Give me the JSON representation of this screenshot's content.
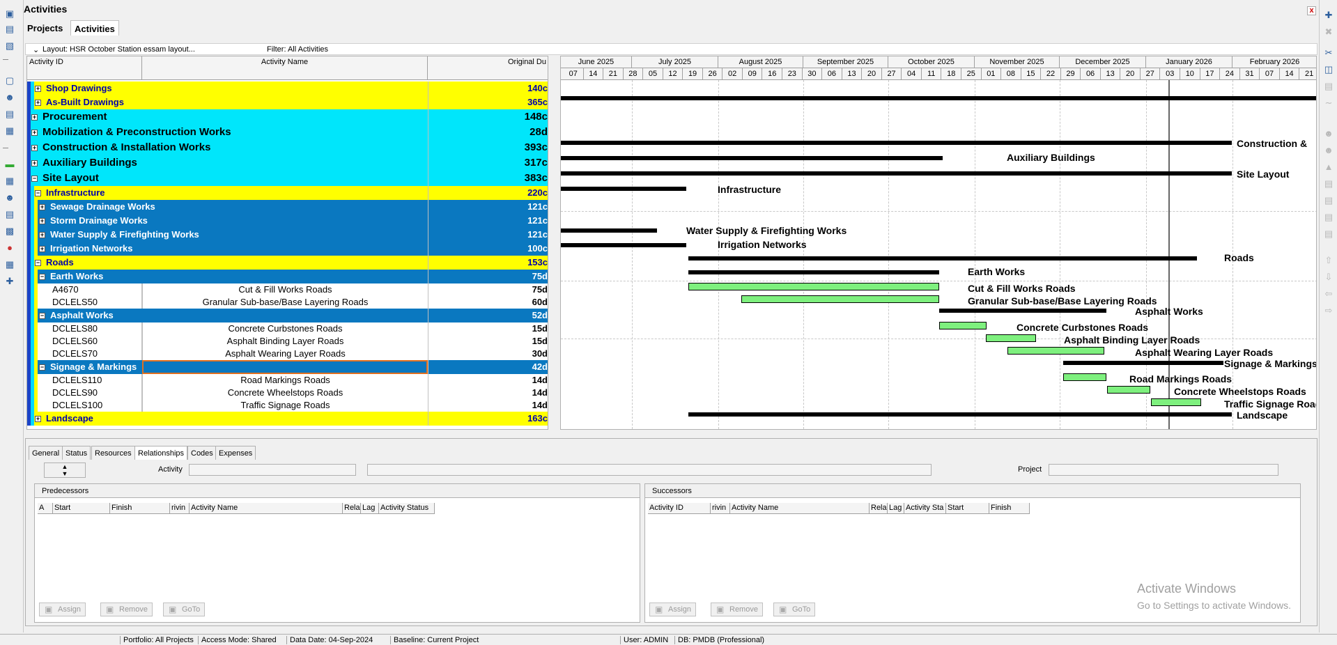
{
  "window": {
    "title": "Activities",
    "close_label": "x"
  },
  "tabs": [
    {
      "label": "Projects"
    },
    {
      "label": "Activities"
    }
  ],
  "layout_bar": {
    "layout": "Layout: HSR October Station essam layout...",
    "filter": "Filter: All Activities"
  },
  "grid": {
    "columns": [
      "Activity ID",
      "Activity Name",
      "Original Du"
    ],
    "rows": [
      {
        "id": "Shop Drawings",
        "name": "",
        "dur": "140c",
        "style": "yel",
        "level": 1
      },
      {
        "id": "As-Built Drawings",
        "name": "",
        "dur": "365c",
        "style": "yel",
        "level": 1
      },
      {
        "id": "Procurement",
        "name": "",
        "dur": "148c",
        "style": "cyan",
        "level": 0
      },
      {
        "id": "Mobilization & Preconstruction Works",
        "name": "",
        "dur": "28d",
        "style": "cyan",
        "level": 0
      },
      {
        "id": "Construction & Installation Works",
        "name": "",
        "dur": "393c",
        "style": "cyan",
        "level": 0
      },
      {
        "id": "Auxiliary Buildings",
        "name": "",
        "dur": "317c",
        "style": "cyan",
        "level": 0
      },
      {
        "id": "Site Layout",
        "name": "",
        "dur": "383c",
        "style": "cyan",
        "level": 0
      },
      {
        "id": "Infrastructure",
        "name": "",
        "dur": "220c",
        "style": "yel",
        "level": 1
      },
      {
        "id": "Sewage Drainage Works",
        "name": "",
        "dur": "121c",
        "style": "blue",
        "level": 2
      },
      {
        "id": "Storm Drainage Works",
        "name": "",
        "dur": "121c",
        "style": "blue",
        "level": 2
      },
      {
        "id": "Water Supply & Firefighting Works",
        "name": "",
        "dur": "121c",
        "style": "blue",
        "level": 2
      },
      {
        "id": "Irrigation Networks",
        "name": "",
        "dur": "100c",
        "style": "blue",
        "level": 2
      },
      {
        "id": "Roads",
        "name": "",
        "dur": "153c",
        "style": "yel",
        "level": 1
      },
      {
        "id": "Earth Works",
        "name": "",
        "dur": "75d",
        "style": "blue",
        "level": 2
      },
      {
        "id": "A4670",
        "name": "Cut & Fill Works Roads",
        "dur": "75d",
        "style": "wht",
        "level": 3
      },
      {
        "id": "DCLELS50",
        "name": "Granular Sub-base/Base Layering Roads",
        "dur": "60d",
        "style": "wht",
        "level": 3
      },
      {
        "id": "Asphalt Works",
        "name": "",
        "dur": "52d",
        "style": "blue",
        "level": 2
      },
      {
        "id": "DCLELS80",
        "name": "Concrete Curbstones Roads",
        "dur": "15d",
        "style": "wht",
        "level": 3
      },
      {
        "id": "DCLELS60",
        "name": "Asphalt Binding Layer Roads",
        "dur": "15d",
        "style": "wht",
        "level": 3
      },
      {
        "id": "DCLELS70",
        "name": "Asphalt Wearing Layer Roads",
        "dur": "30d",
        "style": "wht",
        "level": 3
      },
      {
        "id": "Signage & Markings",
        "name": "",
        "dur": "42d",
        "style": "blue",
        "level": 2,
        "selected": true
      },
      {
        "id": "DCLELS110",
        "name": "Road Markings Roads",
        "dur": "14d",
        "style": "wht",
        "level": 3
      },
      {
        "id": "DCLELS90",
        "name": "Concrete Wheelstops Roads",
        "dur": "14d",
        "style": "wht",
        "level": 3
      },
      {
        "id": "DCLELS100",
        "name": "Traffic Signage Roads",
        "dur": "14d",
        "style": "wht",
        "level": 3
      },
      {
        "id": "Landscape",
        "name": "",
        "dur": "163c",
        "style": "yel",
        "level": 1
      }
    ]
  },
  "gantt": {
    "months": [
      "June 2025",
      "July 2025",
      "August 2025",
      "September 2025",
      "October 2025",
      "November 2025",
      "December 2025",
      "January 2026",
      "February 2026"
    ],
    "days": [
      "07",
      "14",
      "21",
      "28",
      "05",
      "12",
      "19",
      "26",
      "02",
      "09",
      "16",
      "23",
      "30",
      "06",
      "13",
      "20",
      "27",
      "04",
      "11",
      "18",
      "25",
      "01",
      "08",
      "15",
      "22",
      "29",
      "06",
      "13",
      "20",
      "27",
      "03",
      "10",
      "17",
      "24",
      "31",
      "07",
      "14",
      "21"
    ],
    "labels": [
      "Construction &",
      "Auxiliary Buildings",
      "Site Layout",
      "Infrastructure",
      "Water Supply & Firefighting Works",
      "Irrigation Networks",
      "Roads",
      "Earth Works",
      "Cut & Fill Works Roads",
      "Granular Sub-base/Base Layering Roads",
      "Asphalt Works",
      "Concrete Curbstones Roads",
      "Asphalt Binding Layer Roads",
      "Asphalt Wearing Layer Roads",
      "Signage & Markings",
      "Road Markings Roads",
      "Concrete Wheelstops Roads",
      "Traffic Signage Roads",
      "Landscape"
    ]
  },
  "details": {
    "tabs": [
      "General",
      "Status",
      "Resources",
      "Relationships",
      "Codes",
      "Expenses"
    ],
    "activity_label": "Activity",
    "project_label": "Project",
    "predecessors": {
      "title": "Predecessors",
      "columns": [
        "A",
        "Start",
        "Finish",
        "rivin",
        "Activity Name",
        "Rela",
        "Lag",
        "Activity Status"
      ],
      "buttons": [
        "Assign",
        "Remove",
        "GoTo"
      ]
    },
    "successors": {
      "title": "Successors",
      "columns": [
        "Activity ID",
        "rivin",
        "Activity Name",
        "Rela",
        "Lag",
        "Activity Sta",
        "Start",
        "Finish"
      ],
      "buttons": [
        "Assign",
        "Remove",
        "GoTo"
      ]
    }
  },
  "watermark": {
    "line1": "Activate Windows",
    "line2": "Go to Settings to activate Windows."
  },
  "statusbar": {
    "portfolio": "Portfolio: All Projects",
    "access": "Access Mode: Shared",
    "data_date": "Data Date: 04-Sep-2024",
    "baseline": "Baseline: Current Project",
    "user": "User: ADMIN",
    "db": "DB: PMDB (Professional)"
  },
  "colors": {
    "yellow_band": "#ffff00",
    "cyan_band": "#00e6fb",
    "blue_band": "#0a78c0",
    "bar_fill": "#7ef07e"
  }
}
